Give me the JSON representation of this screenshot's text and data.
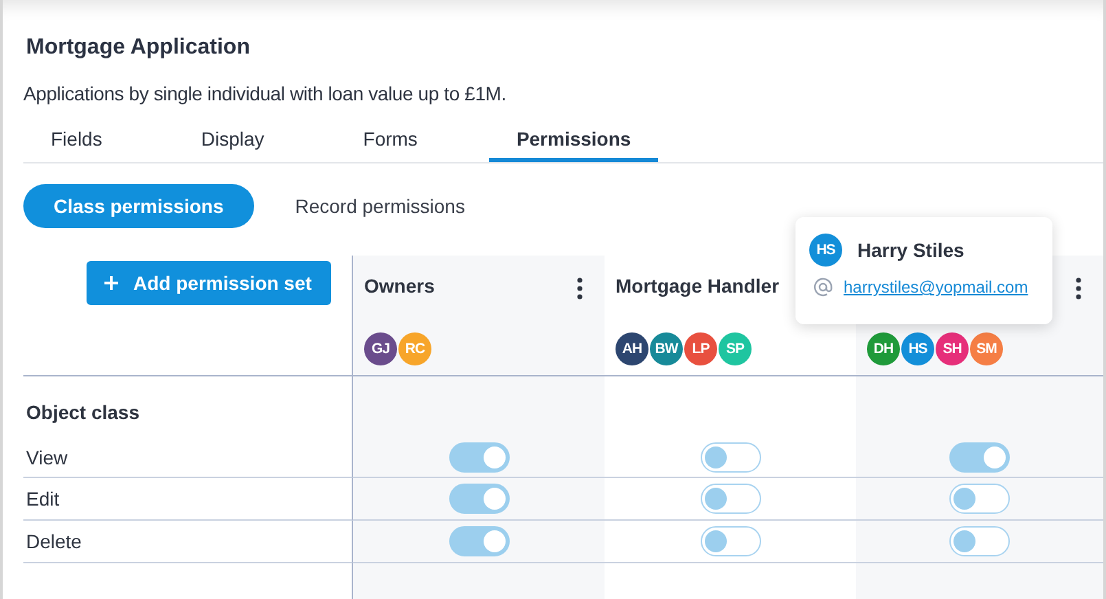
{
  "title": "Mortgage Application",
  "description": "Applications by single individual with loan value up to £1M.",
  "tabs": [
    {
      "label": "Fields",
      "selected": false
    },
    {
      "label": "Display",
      "selected": false
    },
    {
      "label": "Forms",
      "selected": false
    },
    {
      "label": "Permissions",
      "selected": true
    }
  ],
  "sub_tabs": [
    {
      "label": "Class permissions",
      "selected": true
    },
    {
      "label": "Record permissions",
      "selected": false
    }
  ],
  "add_button": "Add permission set",
  "columns": [
    {
      "name": "Owners",
      "menu": true,
      "members": [
        {
          "initials": "GJ",
          "color": "#6a4c8c"
        },
        {
          "initials": "RC",
          "color": "#f7a52a"
        }
      ]
    },
    {
      "name": "Mortgage Handler",
      "menu": false,
      "members": [
        {
          "initials": "AH",
          "color": "#2d4670"
        },
        {
          "initials": "BW",
          "color": "#178a99"
        },
        {
          "initials": "LP",
          "color": "#e8503f"
        },
        {
          "initials": "SP",
          "color": "#1fc5a0"
        }
      ]
    },
    {
      "menu": true,
      "members": [
        {
          "initials": "DH",
          "color": "#1f9a3a"
        },
        {
          "initials": "HS",
          "color": "#138fd9"
        },
        {
          "initials": "SH",
          "color": "#e62f7a"
        },
        {
          "initials": "SM",
          "color": "#f57e45"
        }
      ]
    }
  ],
  "section": "Object class",
  "rows": [
    {
      "label": "View",
      "on": [
        true,
        false,
        true
      ]
    },
    {
      "label": "Edit",
      "on": [
        true,
        false,
        false
      ]
    },
    {
      "label": "Delete",
      "on": [
        true,
        false,
        false
      ]
    }
  ],
  "popover": {
    "initials": "HS",
    "color": "#138fd9",
    "name": "Harry Stiles",
    "email": "harrystiles@yopmail.com"
  }
}
